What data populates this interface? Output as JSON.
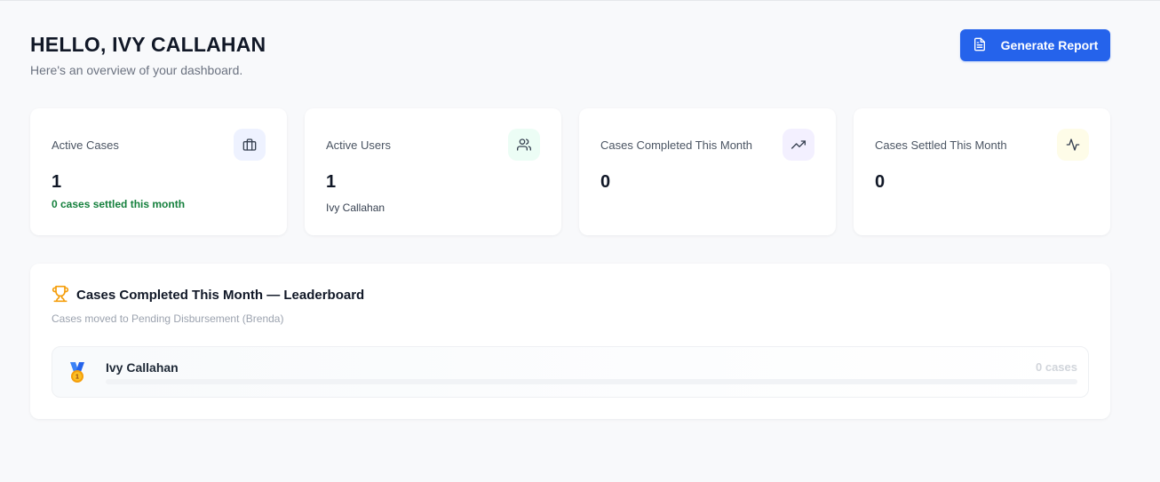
{
  "header": {
    "greeting": "HELLO, IVY CALLAHAN",
    "subtitle": "Here's an overview of your dashboard.",
    "report_button": "Generate Report"
  },
  "stats": [
    {
      "label": "Active Cases",
      "value": "1",
      "note": "0 cases settled this month",
      "icon": "briefcase-icon",
      "icon_bg": "#eef2ff",
      "icon_color": "#374151"
    },
    {
      "label": "Active Users",
      "value": "1",
      "note": "Ivy Callahan",
      "icon": "users-icon",
      "icon_bg": "#ecfdf5",
      "icon_color": "#374151"
    },
    {
      "label": "Cases Completed This Month",
      "value": "0",
      "note": "",
      "icon": "trending-up-icon",
      "icon_bg": "#f3f0ff",
      "icon_color": "#374151"
    },
    {
      "label": "Cases Settled This Month",
      "value": "0",
      "note": "",
      "icon": "activity-icon",
      "icon_bg": "#fefce8",
      "icon_color": "#374151"
    }
  ],
  "leaderboard": {
    "title": "Cases Completed This Month — Leaderboard",
    "description": "Cases moved to Pending Disbursement (Brenda)",
    "entries": [
      {
        "rank": "1",
        "name": "Ivy Callahan",
        "count": "0 cases",
        "progress": 0
      }
    ]
  },
  "colors": {
    "accent": "#2563eb",
    "positive": "#15803d",
    "trophy": "#f59e0b",
    "medal": "#f59e0b"
  }
}
